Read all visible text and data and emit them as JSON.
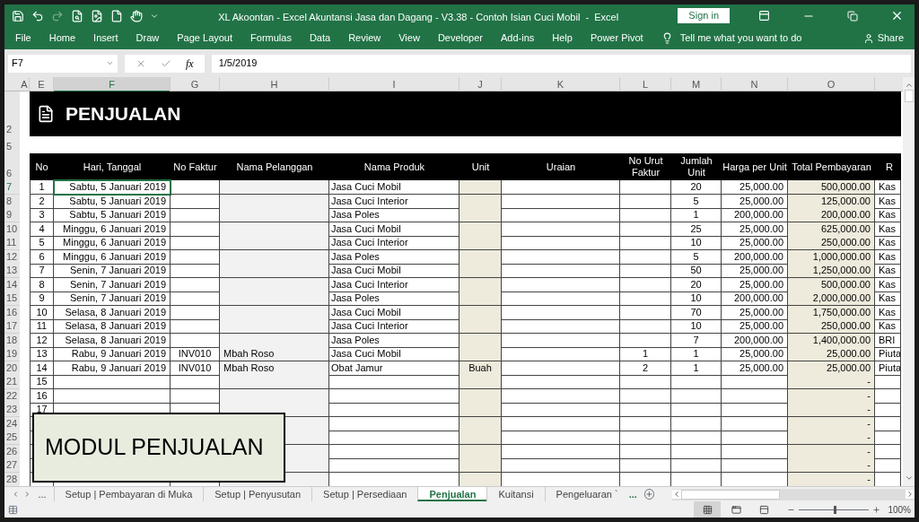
{
  "title_bar": {
    "title": "XL Akoontan - Excel Akuntansi Jasa dan Dagang - V3.38 - Contoh Isian Cuci Mobil  -  Excel",
    "sign_in": "Sign in"
  },
  "ribbon_tabs": [
    "File",
    "Home",
    "Insert",
    "Draw",
    "Page Layout",
    "Formulas",
    "Data",
    "Review",
    "View",
    "Developer",
    "Add-ins",
    "Help",
    "Power Pivot"
  ],
  "tell_me": "Tell me what you want to do",
  "share": "Share",
  "formula_bar": {
    "name_box": "F7",
    "fx": "fx",
    "value": "1/5/2019"
  },
  "column_headers": [
    {
      "label": "A",
      "selected": false
    },
    {
      "label": "E",
      "selected": false
    },
    {
      "label": "F",
      "selected": true
    },
    {
      "label": "G",
      "selected": false
    },
    {
      "label": "H",
      "selected": false
    },
    {
      "label": "I",
      "selected": false
    },
    {
      "label": "J",
      "selected": false
    },
    {
      "label": "K",
      "selected": false
    },
    {
      "label": "L",
      "selected": false
    },
    {
      "label": "M",
      "selected": false
    },
    {
      "label": "N",
      "selected": false
    },
    {
      "label": "O",
      "selected": false
    }
  ],
  "sheet": {
    "title": "PENJUALAN",
    "title_row": "2",
    "spacer_row": "5",
    "header_row": "6",
    "columns": [
      "No",
      "Hari, Tanggal",
      "No Faktur",
      "Nama Pelanggan",
      "Nama Produk",
      "Unit",
      "Uraian",
      "No Urut Faktur",
      "Jumlah Unit",
      "Harga per Unit",
      "Total Pembayaran",
      "R"
    ],
    "rows": [
      {
        "row": "7",
        "selected": true,
        "no": "1",
        "date": "Sabtu, 5 Januari 2019",
        "product": "Jasa Cuci Mobil",
        "qty": "20",
        "price": "25,000.00",
        "total": "500,000.00",
        "account": "Kas"
      },
      {
        "row": "8",
        "selected": false,
        "no": "2",
        "date": "Sabtu, 5 Januari 2019",
        "product": "Jasa Cuci Interior",
        "qty": "5",
        "price": "25,000.00",
        "total": "125,000.00",
        "account": "Kas"
      },
      {
        "row": "9",
        "selected": false,
        "no": "3",
        "date": "Sabtu, 5 Januari 2019",
        "product": "Jasa Poles",
        "qty": "1",
        "price": "200,000.00",
        "total": "200,000.00",
        "account": "Kas"
      },
      {
        "row": "10",
        "selected": false,
        "no": "4",
        "date": "Minggu, 6 Januari 2019",
        "product": "Jasa Cuci Mobil",
        "qty": "25",
        "price": "25,000.00",
        "total": "625,000.00",
        "account": "Kas"
      },
      {
        "row": "11",
        "selected": false,
        "no": "5",
        "date": "Minggu, 6 Januari 2019",
        "product": "Jasa Cuci Interior",
        "qty": "10",
        "price": "25,000.00",
        "total": "250,000.00",
        "account": "Kas"
      },
      {
        "row": "12",
        "selected": false,
        "no": "6",
        "date": "Minggu, 6 Januari 2019",
        "product": "Jasa Poles",
        "qty": "5",
        "price": "200,000.00",
        "total": "1,000,000.00",
        "account": "Kas"
      },
      {
        "row": "13",
        "selected": false,
        "no": "7",
        "date": "Senin, 7 Januari 2019",
        "product": "Jasa Cuci Mobil",
        "qty": "50",
        "price": "25,000.00",
        "total": "1,250,000.00",
        "account": "Kas"
      },
      {
        "row": "14",
        "selected": false,
        "no": "8",
        "date": "Senin, 7 Januari 2019",
        "product": "Jasa Cuci Interior",
        "qty": "20",
        "price": "25,000.00",
        "total": "500,000.00",
        "account": "Kas"
      },
      {
        "row": "15",
        "selected": false,
        "no": "9",
        "date": "Senin, 7 Januari 2019",
        "product": "Jasa Poles",
        "qty": "10",
        "price": "200,000.00",
        "total": "2,000,000.00",
        "account": "Kas"
      },
      {
        "row": "16",
        "selected": false,
        "no": "10",
        "date": "Selasa, 8 Januari 2019",
        "product": "Jasa Cuci Mobil",
        "qty": "70",
        "price": "25,000.00",
        "total": "1,750,000.00",
        "account": "Kas"
      },
      {
        "row": "17",
        "selected": false,
        "no": "11",
        "date": "Selasa, 8 Januari 2019",
        "product": "Jasa Cuci Interior",
        "qty": "10",
        "price": "25,000.00",
        "total": "250,000.00",
        "account": "Kas"
      },
      {
        "row": "18",
        "selected": false,
        "no": "12",
        "date": "Selasa, 8 Januari 2019",
        "product": "Jasa Poles",
        "qty": "7",
        "price": "200,000.00",
        "total": "1,400,000.00",
        "account": "BRI"
      },
      {
        "row": "19",
        "selected": false,
        "no": "13",
        "date": "Rabu, 9 Januari 2019",
        "invoice": "INV010",
        "customer": "Mbah Roso",
        "product": "Jasa Cuci Mobil",
        "order_no": "1",
        "qty": "1",
        "price": "25,000.00",
        "total": "25,000.00",
        "account": "Piuta"
      },
      {
        "row": "20",
        "selected": false,
        "no": "14",
        "date": "Rabu, 9 Januari 2019",
        "invoice": "INV010",
        "customer": "Mbah Roso",
        "product": "Obat Jamur",
        "unit": "Buah",
        "order_no": "2",
        "qty": "1",
        "price": "25,000.00",
        "total": "25,000.00",
        "account": "Piuta"
      },
      {
        "row": "21",
        "selected": false,
        "no": "15",
        "total": "-"
      },
      {
        "row": "22",
        "selected": false,
        "no": "16",
        "total": "-"
      },
      {
        "row": "23",
        "selected": false,
        "no": "17",
        "total": "-"
      },
      {
        "row": "24",
        "selected": false,
        "total": "-"
      },
      {
        "row": "25",
        "selected": false,
        "total": "-"
      },
      {
        "row": "26",
        "selected": false,
        "total": "-"
      },
      {
        "row": "27",
        "selected": false,
        "total": "-"
      },
      {
        "row": "28",
        "selected": false,
        "total": "-"
      }
    ]
  },
  "caption": "MODUL PENJUALAN",
  "sheet_tabs": [
    {
      "label": "Setup | Pembayaran di Muka",
      "selected": false
    },
    {
      "label": "Setup | Penyusutan",
      "selected": false
    },
    {
      "label": "Setup | Persediaan",
      "selected": false
    },
    {
      "label": "Penjualan",
      "selected": true
    },
    {
      "label": "Kuitansi",
      "selected": false
    },
    {
      "label": "Pengeluaran `",
      "selected": false
    }
  ],
  "more_tabs": "...",
  "more_tabs_right": "...",
  "status_bar": {
    "zoom": "100%",
    "zoom_slider": {
      "level": 0.5
    }
  }
}
